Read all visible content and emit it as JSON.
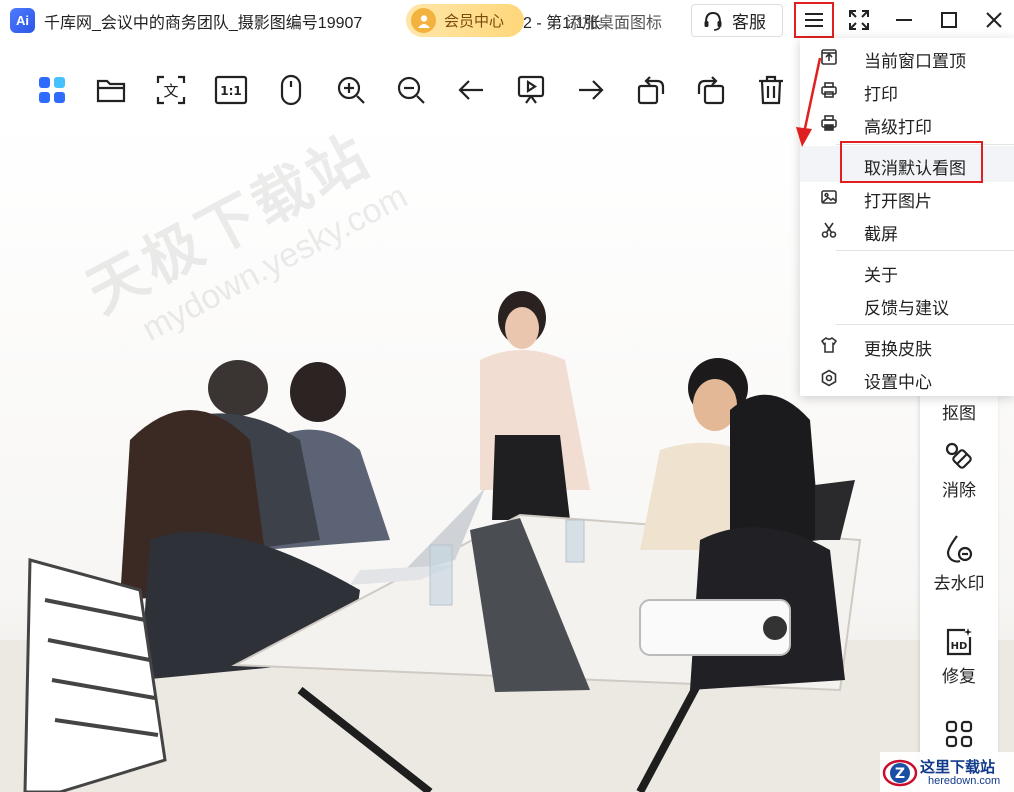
{
  "titlebar": {
    "logo_text": "Ai",
    "title": "千库网_会议中的商务团队_摄影图编号19907",
    "title_tail": "2 - 第1/1张",
    "vip_label": "会员中心",
    "desk_icon_label": "添加桌面图标",
    "service_label": "客服"
  },
  "toolbar": {
    "icons": [
      "apps-icon",
      "folder-icon",
      "ocr-text-icon",
      "actual-size-icon",
      "mouse-icon",
      "zoom-in-icon",
      "zoom-out-icon",
      "previous-icon",
      "slideshow-icon",
      "next-icon",
      "rotate-left-icon",
      "rotate-right-icon",
      "delete-icon"
    ],
    "ocr_glyph": "文",
    "actual_size_glyph": "1:1"
  },
  "menu": {
    "items": [
      {
        "label": "当前窗口置顶",
        "icon": "pin-top-icon"
      },
      {
        "label": "打印",
        "icon": "print-icon"
      },
      {
        "label": "高级打印",
        "icon": "advanced-print-icon"
      },
      {
        "label": "取消默认看图",
        "icon": ""
      },
      {
        "label": "打开图片",
        "icon": "image-icon"
      },
      {
        "label": "截屏",
        "icon": "scissors-icon"
      },
      {
        "label": "关于",
        "icon": ""
      },
      {
        "label": "反馈与建议",
        "icon": ""
      },
      {
        "label": "更换皮肤",
        "icon": "shirt-icon"
      },
      {
        "label": "设置中心",
        "icon": "settings-icon"
      }
    ]
  },
  "side_tools": [
    {
      "label": "抠图",
      "icon": "cutout-icon"
    },
    {
      "label": "消除",
      "icon": "eraser-icon"
    },
    {
      "label": "去水印",
      "icon": "remove-watermark-icon"
    },
    {
      "label": "修复",
      "icon": "hd-repair-icon"
    },
    {
      "label": "",
      "icon": "more-apps-icon"
    }
  ],
  "watermarks": {
    "site_cn": "天极下载站",
    "site_url": "mydown.yesky.com",
    "badge_cn": "这里下载站",
    "badge_url": "heredown.com",
    "badge_letter": "Z"
  },
  "colors": {
    "highlight_red": "#e02020",
    "vip_gold": "#ffd77a",
    "app_blue": "#2b55e6"
  }
}
